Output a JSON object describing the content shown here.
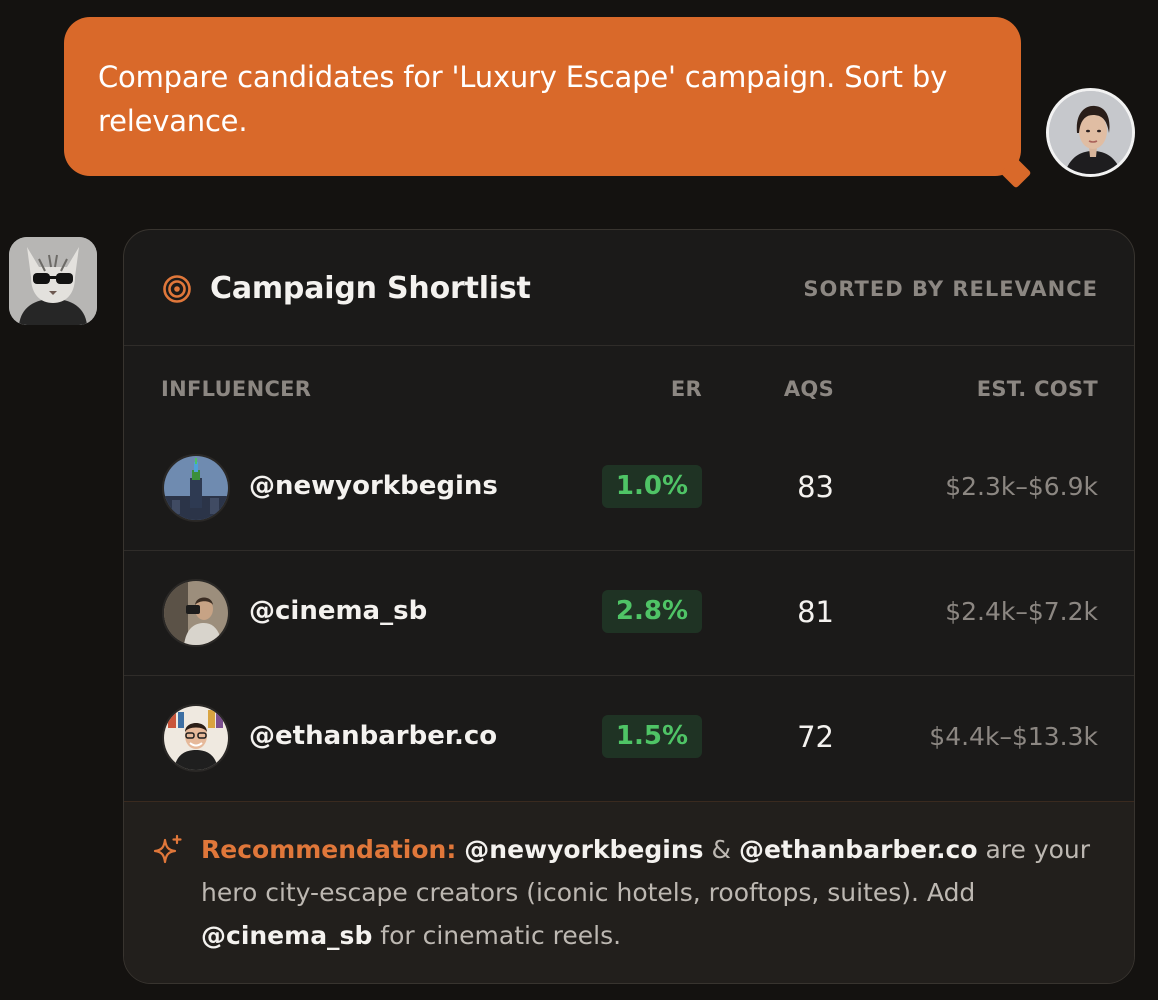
{
  "user_message": {
    "text": "Compare candidates for 'Luxury Escape' campaign. Sort by relevance."
  },
  "card": {
    "title": "Campaign Shortlist",
    "icon": "target-icon",
    "sort_label": "SORTED BY RELEVANCE",
    "columns": {
      "influencer": "INFLUENCER",
      "er": "ER",
      "aqs": "AQS",
      "cost": "EST. COST"
    },
    "rows": [
      {
        "handle": "@newyorkbegins",
        "er": "1.0%",
        "aqs": "83",
        "cost": "$2.3k–$6.9k"
      },
      {
        "handle": "@cinema_sb",
        "er": "2.8%",
        "aqs": "81",
        "cost": "$2.4k–$7.2k"
      },
      {
        "handle": "@ethanbarber.co",
        "er": "1.5%",
        "aqs": "72",
        "cost": "$4.4k–$13.3k"
      }
    ],
    "recommendation": {
      "label": "Recommendation:",
      "handle_1": "@newyorkbegins",
      "amp": " & ",
      "handle_2": "@ethanbarber.co",
      "text_1": " are your hero city-escape creators (iconic hotels, rooftops, suites). Add ",
      "handle_3": "@cinema_sb",
      "text_2": " for cinematic reels."
    }
  },
  "colors": {
    "accent": "#d9692a",
    "er_green": "#4fc466",
    "background": "#141210"
  }
}
